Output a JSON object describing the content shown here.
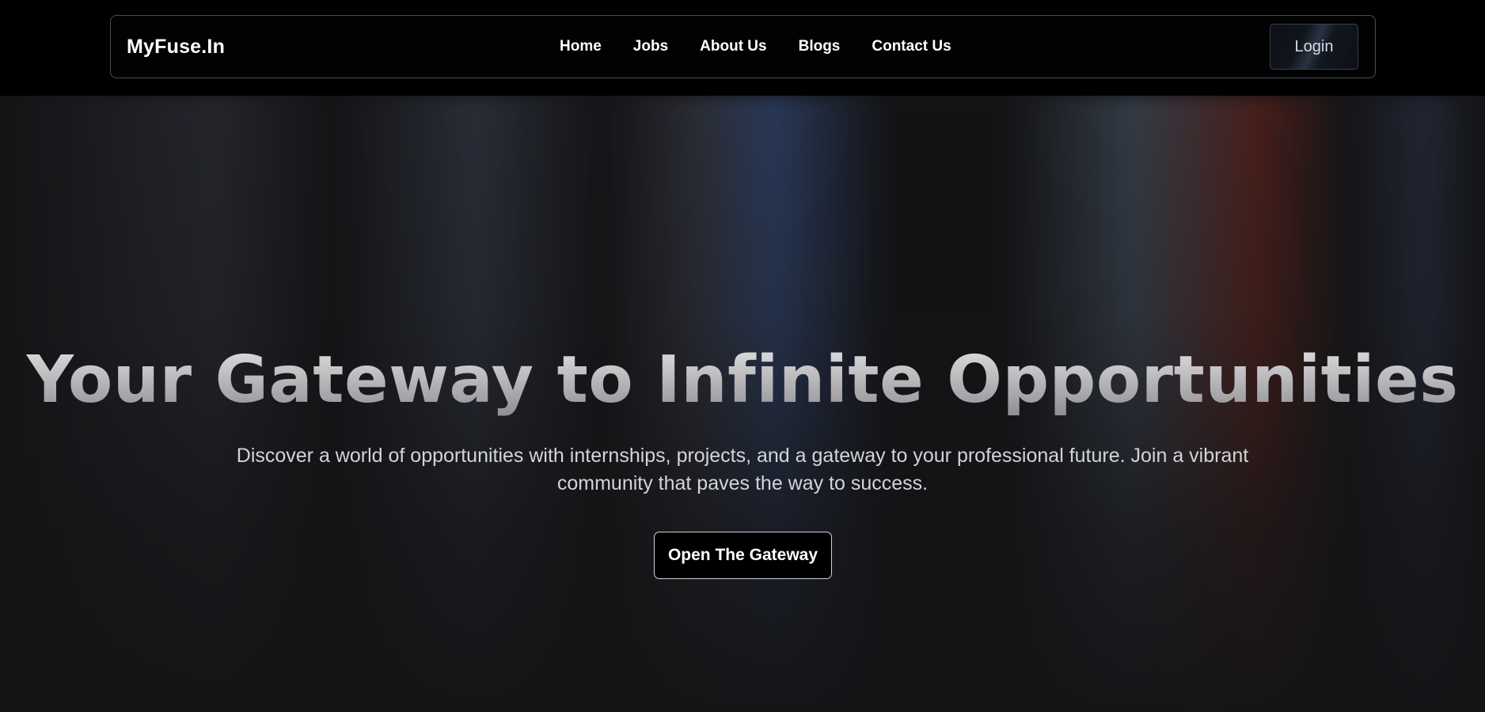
{
  "header": {
    "logo": "MyFuse.In",
    "nav": [
      {
        "label": "Home"
      },
      {
        "label": "Jobs"
      },
      {
        "label": "About Us"
      },
      {
        "label": "Blogs"
      },
      {
        "label": "Contact Us"
      }
    ],
    "login_label": "Login"
  },
  "hero": {
    "title": "Your Gateway to Infinite Opportunities",
    "subtitle": "Discover a world of opportunities with internships, projects, and a gateway to your professional future. Join a vibrant community that paves the way to success.",
    "cta_label": "Open The Gateway"
  },
  "colors": {
    "header_bg": "#000000",
    "page_bg": "#141416",
    "text_primary": "#ffffff",
    "border": "#4a4d57"
  }
}
